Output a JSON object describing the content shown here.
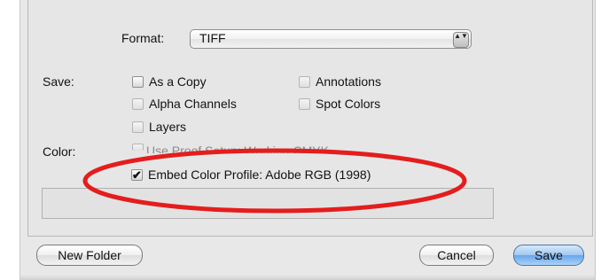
{
  "dialog": {
    "format": {
      "label": "Format:",
      "value": "TIFF",
      "arrows": "▲▼"
    },
    "save": {
      "label": "Save:",
      "options": [
        {
          "label": "As a Copy",
          "checked": false,
          "enabled": true
        },
        {
          "label": "Annotations",
          "checked": false,
          "enabled": false
        },
        {
          "label": "Alpha Channels",
          "checked": false,
          "enabled": false
        },
        {
          "label": "Spot Colors",
          "checked": false,
          "enabled": false
        },
        {
          "label": "Layers",
          "checked": false,
          "enabled": false
        }
      ]
    },
    "color": {
      "label": "Color:",
      "proof_setup": "Use Proof Setup:  Working CMYK",
      "embed_profile": {
        "label": "Embed Color Profile:  Adobe RGB (1998)",
        "checked": true,
        "mark": "✔"
      }
    },
    "buttons": {
      "new_folder": "New Folder",
      "cancel": "Cancel",
      "save": "Save"
    },
    "highlight_color": "#e41d1d"
  }
}
